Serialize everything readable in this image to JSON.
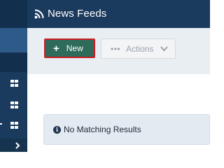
{
  "header": {
    "title": "News Feeds",
    "icon": "rss-icon"
  },
  "toolbar": {
    "new_label": "New",
    "new_icon": "plus-icon",
    "actions_label": "Actions",
    "actions_icon": "ellipsis-icon"
  },
  "alert": {
    "icon": "info-icon",
    "text": "No Matching Results"
  },
  "sidebar": {
    "icons": [
      "dashboard-icon",
      "dashboard-icon",
      "dashboard-icon",
      "chevron-right-icon"
    ]
  },
  "colors": {
    "header_bg": "#1a3a5e",
    "new_button_bg": "#2e6b5a",
    "new_button_highlight": "#cc1f24",
    "toolbar_bg": "#e9eef3",
    "alert_bg": "#e4eaf1"
  }
}
